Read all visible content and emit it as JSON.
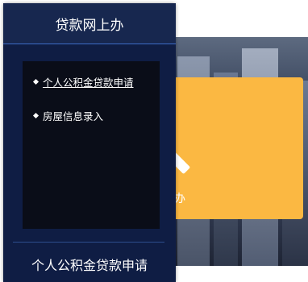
{
  "side_menu": {
    "title": "贷款网上办",
    "items": [
      {
        "label": "个人公积金贷款申请",
        "active": true
      },
      {
        "label": "房屋信息录入",
        "active": false
      }
    ],
    "footer_title": "个人公积金贷款申请"
  },
  "card": {
    "label": "办",
    "icon": "pencil-icon",
    "color": "#fbb842"
  },
  "colors": {
    "panel_bg": "#0f1d44",
    "submenu_bg": "#0a0d18",
    "accent_line": "#3c6cc7"
  }
}
